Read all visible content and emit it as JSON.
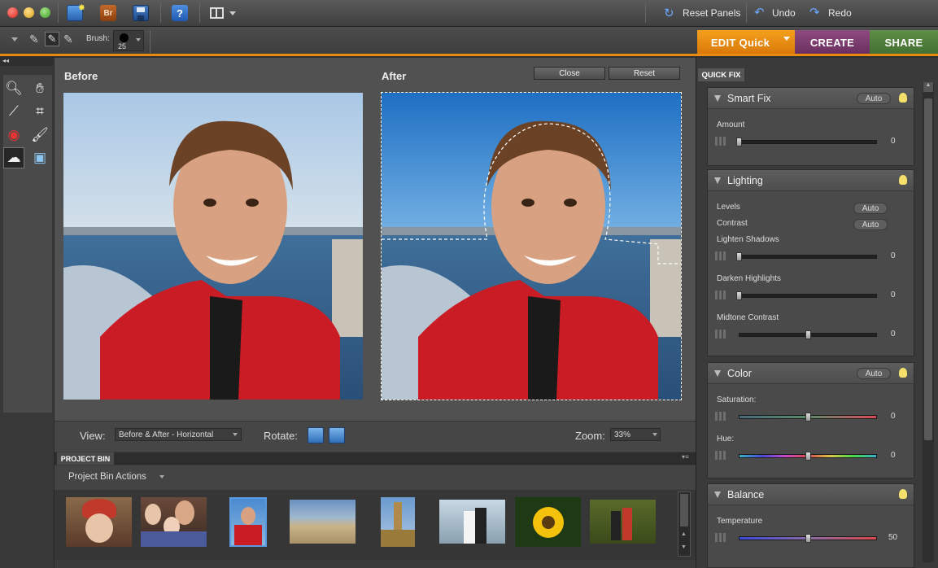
{
  "toolbar": {
    "reset_panels": "Reset Panels",
    "undo": "Undo",
    "redo": "Redo",
    "br_label": "Br",
    "help_label": "?"
  },
  "options": {
    "brush_label": "Brush:",
    "brush_size": "25"
  },
  "modes": {
    "edit": "EDIT Quick",
    "create": "CREATE",
    "share": "SHARE"
  },
  "preview": {
    "before_label": "Before",
    "after_label": "After",
    "close_label": "Close",
    "reset_label": "Reset"
  },
  "viewbar": {
    "view_label": "View:",
    "view_value": "Before & After - Horizontal",
    "rotate_label": "Rotate:",
    "zoom_label": "Zoom:",
    "zoom_value": "33%"
  },
  "bin": {
    "title": "PROJECT BIN",
    "actions": "Project Bin Actions",
    "thumbnails": [
      "girl-red-hat",
      "family",
      "boy-selected",
      "beach-fence",
      "big-ben",
      "wedding",
      "sunflower",
      "couple-field"
    ]
  },
  "quickfix": {
    "tab": "QUICK FIX",
    "smart_fix": {
      "title": "Smart Fix",
      "auto": "Auto",
      "amount_label": "Amount",
      "amount_value": "0"
    },
    "lighting": {
      "title": "Lighting",
      "levels_label": "Levels",
      "levels_auto": "Auto",
      "contrast_label": "Contrast",
      "contrast_auto": "Auto",
      "lighten_label": "Lighten Shadows",
      "lighten_value": "0",
      "darken_label": "Darken Highlights",
      "darken_value": "0",
      "midtone_label": "Midtone Contrast",
      "midtone_value": "0"
    },
    "color": {
      "title": "Color",
      "auto": "Auto",
      "saturation_label": "Saturation:",
      "saturation_value": "0",
      "hue_label": "Hue:",
      "hue_value": "0"
    },
    "balance": {
      "title": "Balance",
      "temperature_label": "Temperature",
      "temperature_value": "50"
    }
  },
  "colors": {
    "accent_orange": "#e88a10",
    "create_purple": "#7b3a6e",
    "share_green": "#4e7b3a"
  }
}
